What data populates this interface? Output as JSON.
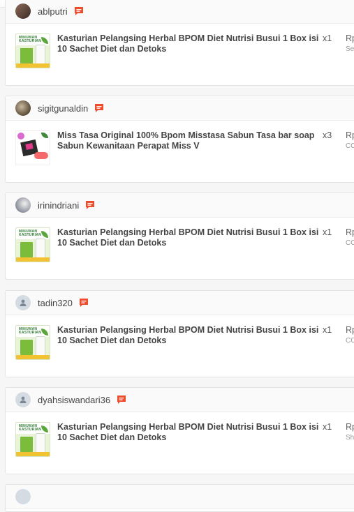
{
  "orders": [
    {
      "username": "ablputri",
      "avatar": "photo1",
      "product": "Kasturian Pelangsing Herbal BPOM Diet Nutrisi Busui 1 Box isi 10 Sachet Diet dan Detoks",
      "image": "kasturian",
      "qty": "x1",
      "price": "Rp",
      "shipping": "Se"
    },
    {
      "username": "sigitgunaldin",
      "avatar": "photo2",
      "product": "Miss Tasa Original 100% Bpom Misstasa Sabun Tasa bar soap Sabun Kewanitaan Perapat Miss V",
      "image": "misstasa",
      "qty": "x3",
      "price": "Rp",
      "shipping": "CC"
    },
    {
      "username": "irinindriani",
      "avatar": "photo3",
      "product": "Kasturian Pelangsing Herbal BPOM Diet Nutrisi Busui 1 Box isi 10 Sachet Diet dan Detoks",
      "image": "kasturian",
      "qty": "x1",
      "price": "Rp",
      "shipping": "CC"
    },
    {
      "username": "tadin320",
      "avatar": "default",
      "product": "Kasturian Pelangsing Herbal BPOM Diet Nutrisi Busui 1 Box isi 10 Sachet Diet dan Detoks",
      "image": "kasturian",
      "qty": "x1",
      "price": "Rp",
      "shipping": "CC"
    },
    {
      "username": "dyahsiswandari36",
      "avatar": "default",
      "product": "Kasturian Pelangsing Herbal BPOM Diet Nutrisi Busui 1 Box isi 10 Sachet Diet dan Detoks",
      "image": "kasturian",
      "qty": "x1",
      "price": "Rp",
      "shipping": "Sh"
    }
  ],
  "thumb_text": {
    "kasturian": "MINUMAN KASTURIAN"
  },
  "colors": {
    "chat_icon": "#ee4d2d",
    "card_border": "#e3e3e3",
    "header_bg": "#fafafa"
  },
  "icons": {
    "chat": "chat-icon",
    "default_avatar": "user-icon"
  }
}
